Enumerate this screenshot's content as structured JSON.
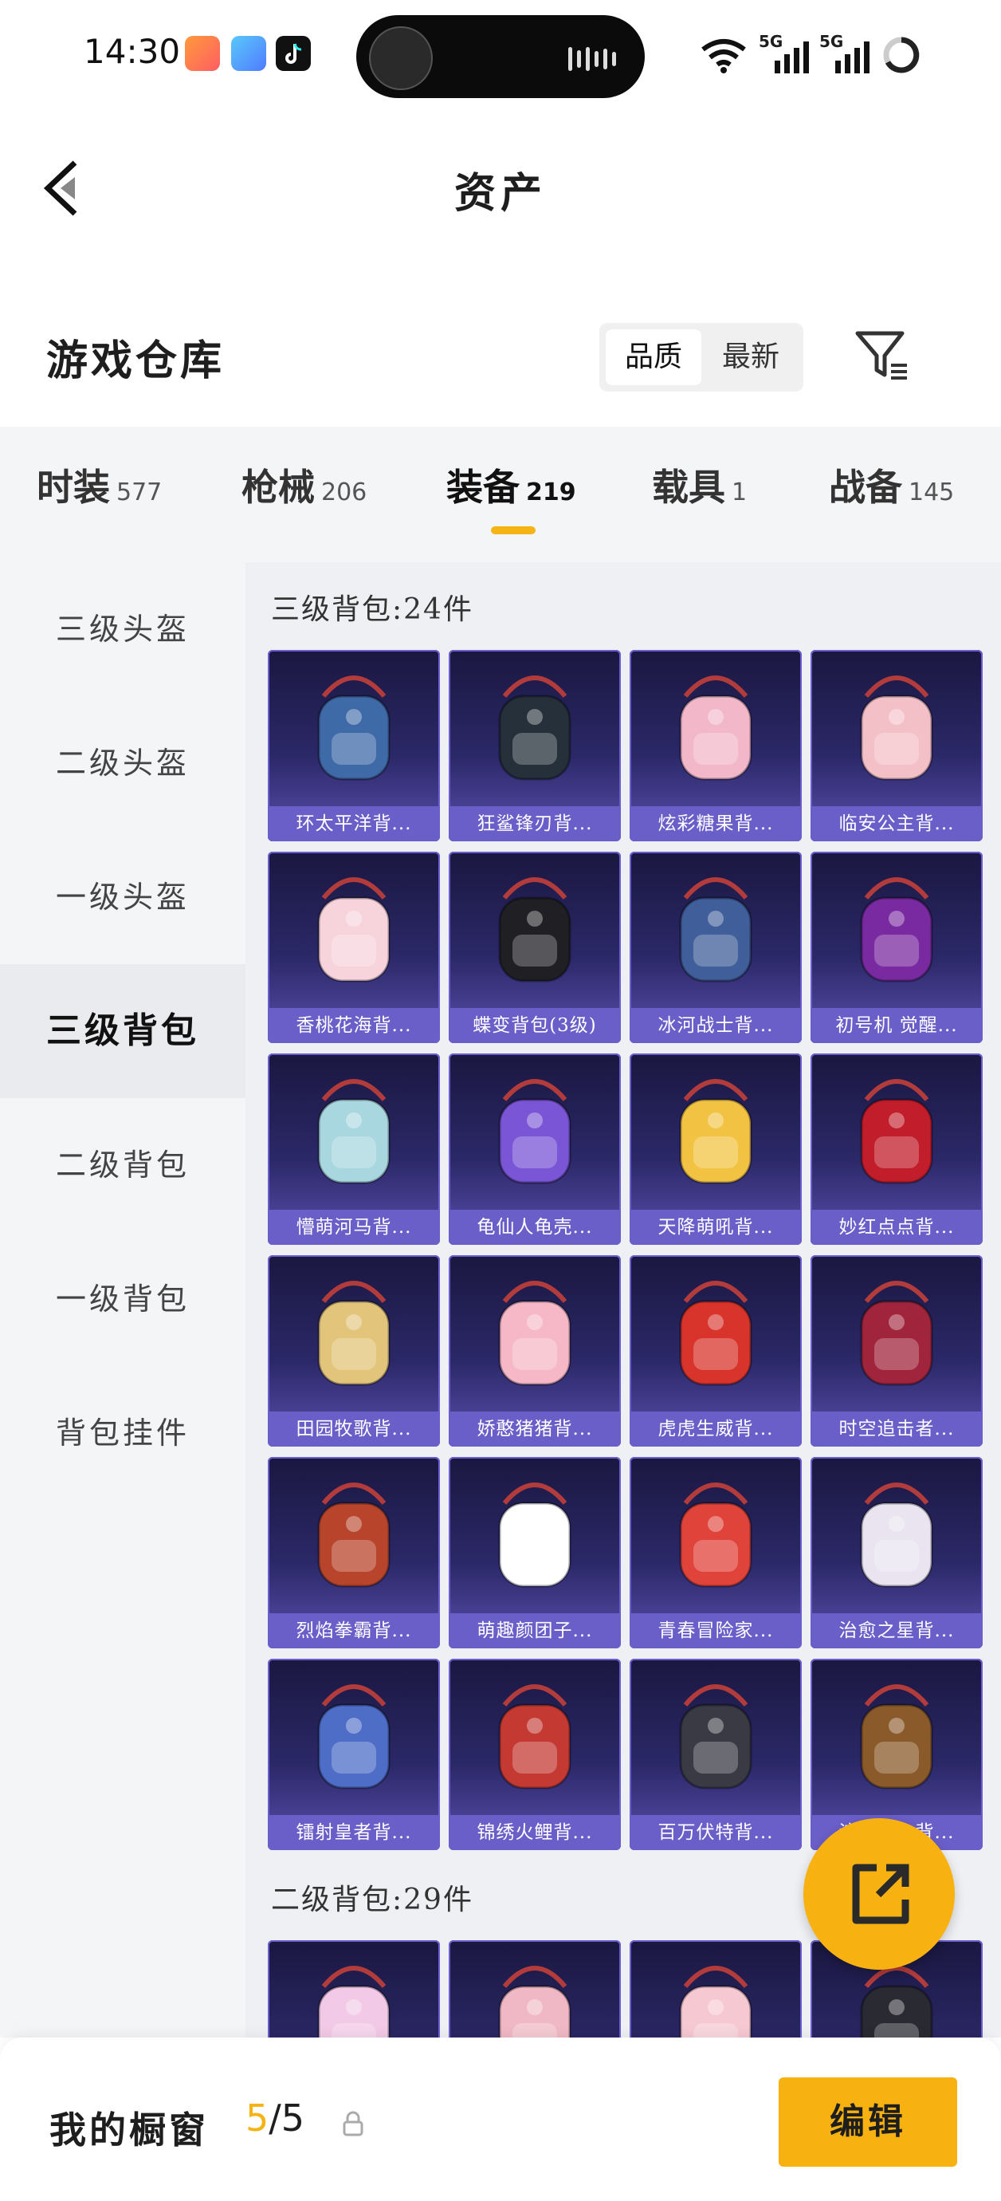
{
  "status": {
    "time": "14:30",
    "net1": "5G",
    "net2": "5G"
  },
  "header": {
    "title": "资产"
  },
  "section": {
    "title": "游戏仓库",
    "sort_quality": "品质",
    "sort_newest": "最新"
  },
  "tabs": [
    {
      "label": "时装",
      "count": "577"
    },
    {
      "label": "枪械",
      "count": "206"
    },
    {
      "label": "装备",
      "count": "219"
    },
    {
      "label": "载具",
      "count": "1"
    },
    {
      "label": "战备",
      "count": "145"
    }
  ],
  "sidebar": [
    "三级头盔",
    "二级头盔",
    "一级头盔",
    "三级背包",
    "二级背包",
    "一级背包",
    "背包挂件"
  ],
  "groups": {
    "g1_title": "三级背包:24件",
    "g2_title": "二级背包:29件"
  },
  "items": [
    "环太平洋背...",
    "狂鲨锋刃背...",
    "炫彩糖果背...",
    "临安公主背...",
    "香桃花海背...",
    "蝶变背包(3级)",
    "冰河战士背...",
    "初号机 觉醒...",
    "懵萌河马背...",
    "龟仙人龟壳...",
    "天降萌吼背...",
    "妙红点点背...",
    "田园牧歌背...",
    "娇憨猪猪背...",
    "虎虎生威背...",
    "时空追击者...",
    "烈焰拳霸背...",
    "萌趣颜团子...",
    "青春冒险家...",
    "治愈之星背...",
    "镭射皇者背...",
    "锦绣火鲤背...",
    "百万伏特背...",
    "浪客之上背..."
  ],
  "item_colors": [
    "#3f6aa8",
    "#26303a",
    "#f2b7c9",
    "#f4c0c8",
    "#f7d4dc",
    "#1f1f24",
    "#3f5e9a",
    "#7a2aa0",
    "#a9d7e0",
    "#7a55d6",
    "#f2c343",
    "#c21d2a",
    "#e2c47a",
    "#f6b8c6",
    "#d8342b",
    "#a0243c",
    "#b8452b",
    "#ffffff",
    "#e0433a",
    "#e9e4f0",
    "#4d6dc7",
    "#c43a33",
    "#3a3a44",
    "#8a5a2a"
  ],
  "bottom": {
    "showcase_label": "我的橱窗",
    "count_current": "5",
    "count_total": "/5",
    "edit_label": "编辑"
  }
}
